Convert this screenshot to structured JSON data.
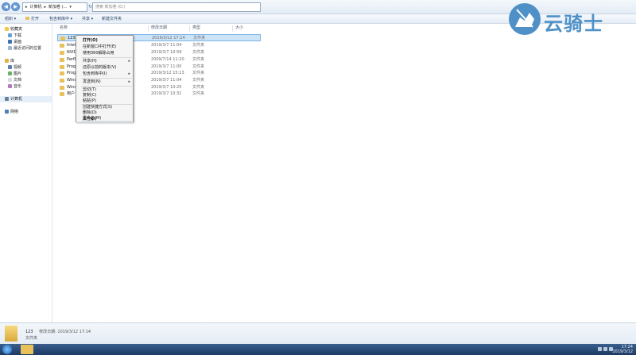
{
  "address": {
    "crumbs": [
      "计算机",
      "新加卷 (..."
    ],
    "search_placeholder": "搜索 新加卷 (D:)"
  },
  "toolbar": {
    "organize": "组织 ▾",
    "open": "打开",
    "include": "包含到库中 ▾",
    "share": "共享 ▾",
    "new_folder": "新建文件夹"
  },
  "nav": {
    "favorites": "收藏夹",
    "downloads": "下载",
    "desktop": "桌面",
    "recent": "最近访问的位置",
    "libraries": "库",
    "videos": "视频",
    "pictures": "图片",
    "documents": "文档",
    "music": "音乐",
    "computer": "计算机",
    "network": "网络"
  },
  "columns": {
    "name": "名称",
    "date": "修改日期",
    "type": "类型",
    "size": "大小"
  },
  "rows": [
    {
      "name": "123",
      "date": "2019/3/12 17:14",
      "type": "文件夹"
    },
    {
      "name": "Intel",
      "date": "2019/3/7 11:04",
      "type": "文件夹"
    },
    {
      "name": "NVID",
      "date": "2019/3/7 10:59",
      "type": "文件夹"
    },
    {
      "name": "PerfL",
      "date": "2009/7/14 11:20",
      "type": "文件夹"
    },
    {
      "name": "Progr",
      "date": "2019/3/7 11:00",
      "type": "文件夹"
    },
    {
      "name": "Progr",
      "date": "2019/3/12 15:13",
      "type": "文件夹"
    },
    {
      "name": "Wind",
      "date": "2019/3/7 11:04",
      "type": "文件夹"
    },
    {
      "name": "Wind",
      "date": "2019/3/7 10:25",
      "type": "文件夹"
    },
    {
      "name": "用户",
      "date": "2019/3/7 10:31",
      "type": "文件夹"
    }
  ],
  "menu": {
    "open": "打开(O)",
    "open_new_window": "在新窗口中打开(E)",
    "open_360": "使用360解除占用",
    "share": "共享(H)",
    "restore": "还原以前的版本(V)",
    "include_library": "包含到库中(I)",
    "send_to": "发送到(N)",
    "cut": "剪切(T)",
    "copy": "复制(C)",
    "paste": "粘贴(P)",
    "create_shortcut": "创建快捷方式(S)",
    "delete": "删除(D)",
    "rename": "重命名(M)",
    "properties": "属性(R)"
  },
  "details": {
    "name": "123",
    "modified_label": "修改日期: 2019/3/12 17:14",
    "type": "文件夹"
  },
  "taskbar": {
    "time": "17:24",
    "date": "2019/3/12"
  },
  "watermark": {
    "text": "云骑士"
  }
}
